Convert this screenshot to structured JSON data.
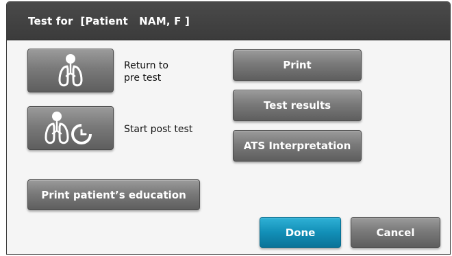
{
  "dialog": {
    "title": "Test for  [Patient   NAM, F ]"
  },
  "actions": {
    "return_pre_test_label": "Return to\npre test",
    "start_post_test_label": "Start post test",
    "print_education_label": "Print patient’s education"
  },
  "side_buttons": {
    "print_label": "Print",
    "test_results_label": "Test results",
    "ats_label": "ATS Interpretation"
  },
  "footer": {
    "done_label": "Done",
    "cancel_label": "Cancel"
  },
  "icons": {
    "return_pre_test": "lungs-patient-icon",
    "start_post_test": "lungs-timer-icon"
  },
  "colors": {
    "titlebar": "#404040",
    "accent_blue": "#128fb7",
    "button_gray": "#7a7a7a"
  }
}
